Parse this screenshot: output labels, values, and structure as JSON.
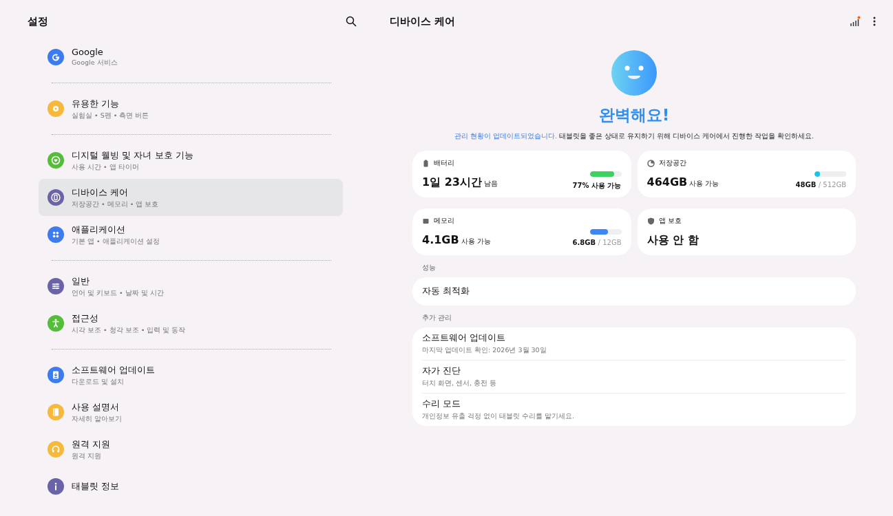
{
  "sidebar": {
    "title": "설정",
    "groups": [
      {
        "items": [
          {
            "kind": "google",
            "title": "Google",
            "subtitle": "Google 서비스",
            "color": "#3d7cf0",
            "selected": false
          }
        ]
      },
      {
        "items": [
          {
            "kind": "flower",
            "title": "유용한 기능",
            "subtitle": "실험실 • S펜 • 측면 버튼",
            "color": "#f7b93c",
            "selected": false
          }
        ]
      },
      {
        "items": [
          {
            "kind": "heart",
            "title": "디지털 웰빙 및 자녀 보호 기능",
            "subtitle": "사용 시간 • 앱 타이머",
            "color": "#56bd3a",
            "selected": false
          },
          {
            "kind": "device",
            "title": "디바이스 케어",
            "subtitle": "저장공간 • 메모리 • 앱 보호",
            "color": "#6a63a8",
            "selected": true
          },
          {
            "kind": "apps",
            "title": "애플리케이션",
            "subtitle": "기본 앱 • 애플리케이션 설정",
            "color": "#3d7cf0",
            "selected": false
          }
        ]
      },
      {
        "items": [
          {
            "kind": "sliders",
            "title": "일반",
            "subtitle": "언어 및 키보드 • 날짜 및 시간",
            "color": "#6a63a8",
            "selected": false
          },
          {
            "kind": "person",
            "title": "접근성",
            "subtitle": "시각 보조 • 청각 보조 • 입력 및 동작",
            "color": "#56bd3a",
            "selected": false
          }
        ]
      },
      {
        "items": [
          {
            "kind": "download",
            "title": "소프트웨어 업데이트",
            "subtitle": "다운로드 및 설치",
            "color": "#3d7cf0",
            "selected": false
          },
          {
            "kind": "book",
            "title": "사용 설명서",
            "subtitle": "자세히 알아보기",
            "color": "#f7b93c",
            "selected": false
          },
          {
            "kind": "headset",
            "title": "원격 지원",
            "subtitle": "원격 지원",
            "color": "#f7b93c",
            "selected": false
          },
          {
            "kind": "info",
            "title": "태블릿 정보",
            "color": "#6a63a8",
            "selected": false
          }
        ]
      }
    ]
  },
  "main": {
    "title": "디바이스 케어",
    "status": "완벽해요!",
    "notice_link": "관리 현황이 업데이트되었습니다.",
    "notice": "태블릿을 좋은 상태로 유지하기 위해 디바이스 케어에서 진행한 작업을 확인하세요.",
    "cards": [
      {
        "kind": "battery",
        "label": "배터리",
        "value": "1일 23시간",
        "unit": "남음",
        "level": 0.77,
        "color": "#3dd160",
        "reading": "77% 사용 가능"
      },
      {
        "kind": "storage",
        "label": "저장공간",
        "value": "464GB",
        "unit": "사용 가능",
        "level": 0.09,
        "color": "#1cc3e8",
        "used": "48GB",
        "total": "/ 512GB"
      },
      {
        "kind": "memory",
        "label": "메모리",
        "value": "4.1GB",
        "unit": "사용 가능",
        "level": 0.57,
        "color": "#3d86f5",
        "used": "6.8GB",
        "total": "/ 12GB"
      },
      {
        "kind": "shield",
        "label": "앱 보호",
        "value": "사용 안 함"
      }
    ],
    "sections": [
      {
        "label": "성능",
        "items": [
          {
            "title": "자동 최적화"
          }
        ]
      },
      {
        "label": "추가 관리",
        "items": [
          {
            "title": "소프트웨어 업데이트",
            "subtitle": "마지막 업데이트 확인: 2026년 3월 30일"
          },
          {
            "title": "자가 진단",
            "subtitle": "터치 화면, 센서, 충전 등"
          },
          {
            "title": "수리 모드",
            "subtitle": "개인정보 유출 걱정 없이 태블릿 수리를 맡기세요."
          }
        ]
      }
    ]
  }
}
